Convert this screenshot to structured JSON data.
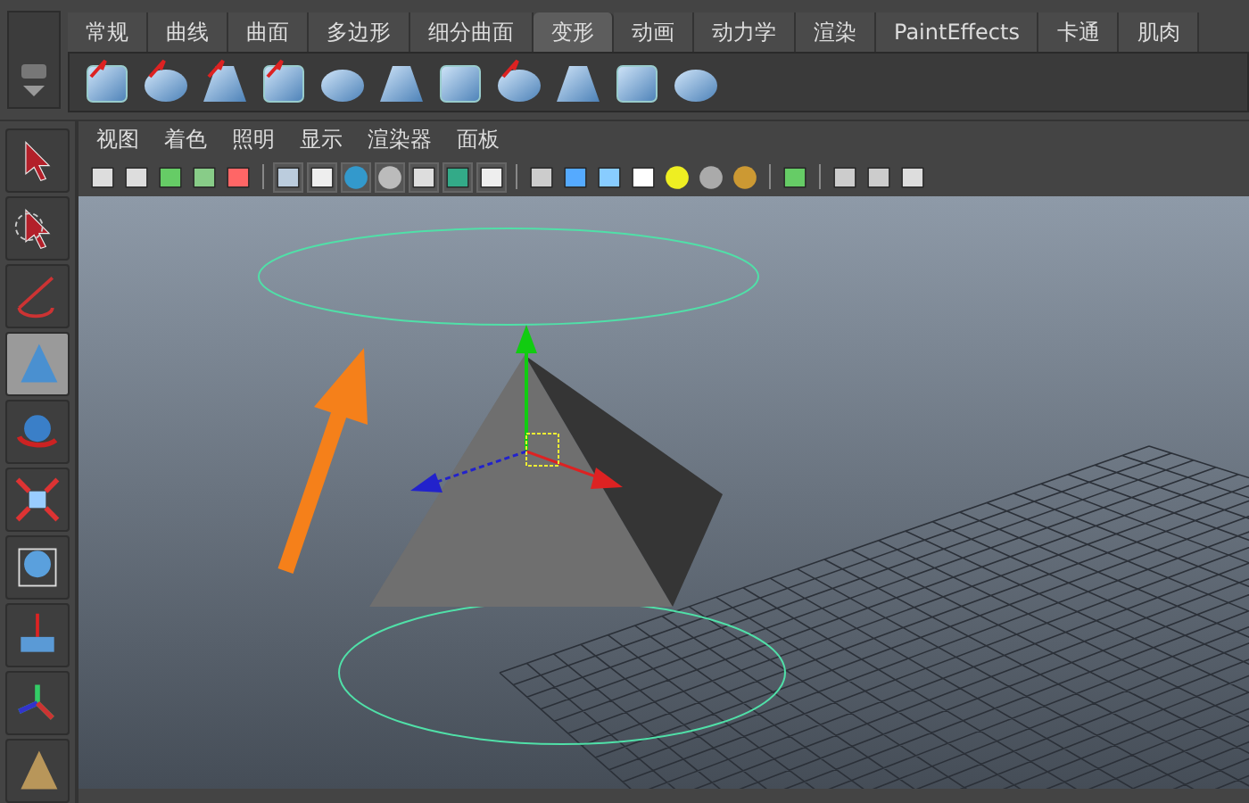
{
  "shelf_tabs": [
    {
      "label": "常规",
      "selected": false
    },
    {
      "label": "曲线",
      "selected": false
    },
    {
      "label": "曲面",
      "selected": false
    },
    {
      "label": "多边形",
      "selected": false
    },
    {
      "label": "细分曲面",
      "selected": false
    },
    {
      "label": "变形",
      "selected": true
    },
    {
      "label": "动画",
      "selected": false
    },
    {
      "label": "动力学",
      "selected": false
    },
    {
      "label": "渲染",
      "selected": false
    },
    {
      "label": "PaintEffects",
      "selected": false
    },
    {
      "label": "卡通",
      "selected": false
    },
    {
      "label": "肌肉",
      "selected": false
    }
  ],
  "tools": [
    {
      "kind": "select",
      "selected": false
    },
    {
      "kind": "lasso",
      "selected": false
    },
    {
      "kind": "paint",
      "selected": false
    },
    {
      "kind": "softmod",
      "selected": true
    },
    {
      "kind": "rotate",
      "selected": false
    },
    {
      "kind": "scale",
      "selected": false
    },
    {
      "kind": "universal",
      "selected": false
    },
    {
      "kind": "move",
      "selected": false
    },
    {
      "kind": "axes",
      "selected": false
    },
    {
      "kind": "pyramid",
      "selected": false
    }
  ],
  "panel_menu": [
    "视图",
    "着色",
    "照明",
    "显示",
    "渲染器",
    "面板"
  ]
}
